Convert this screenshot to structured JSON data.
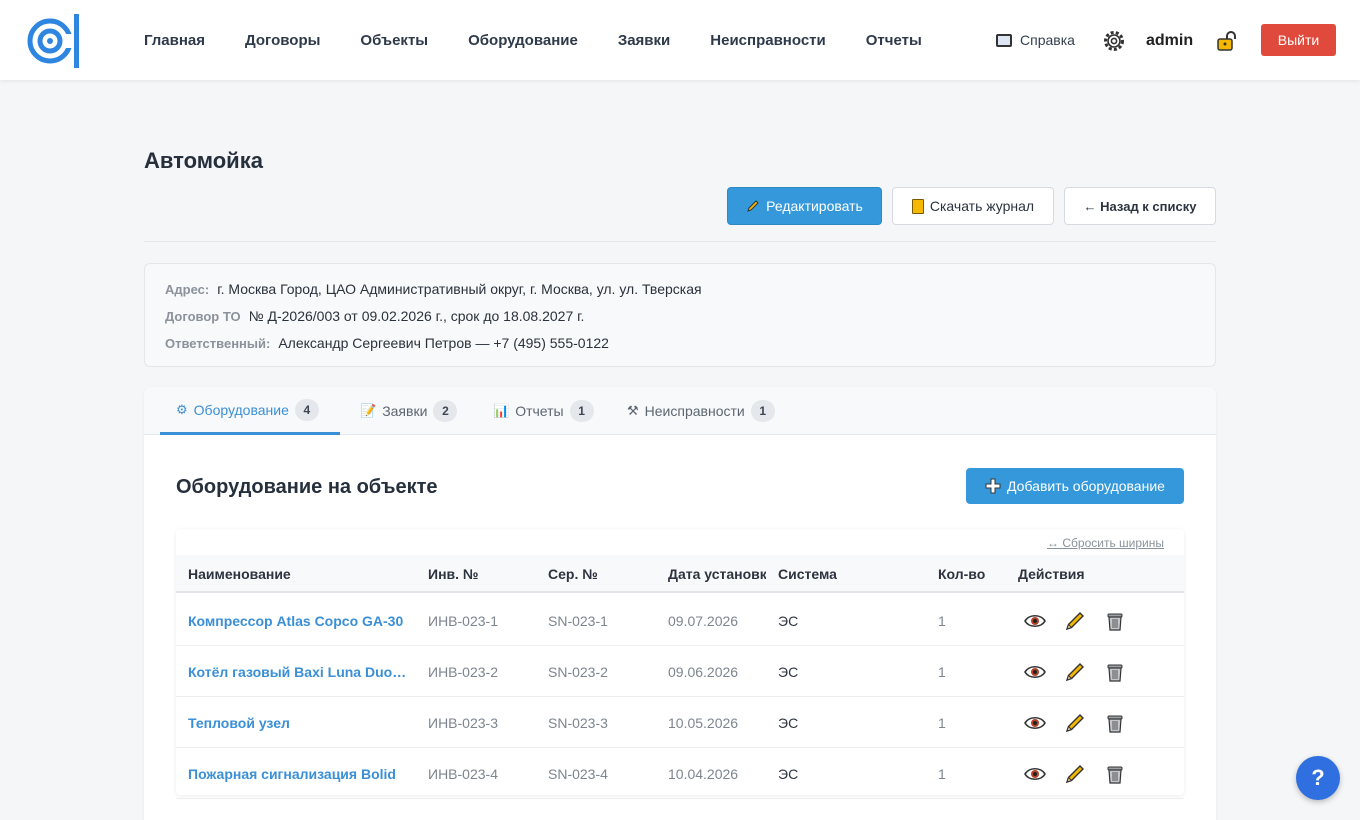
{
  "nav": {
    "items": [
      "Главная",
      "Договоры",
      "Объекты",
      "Оборудование",
      "Заявки",
      "Неисправности",
      "Отчеты"
    ],
    "help_label": "Справка",
    "user": "admin",
    "logout_label": "Выйти"
  },
  "page": {
    "title": "Автомойка",
    "edit_label": "Редактировать",
    "journal_label": "Скачать журнал",
    "back_label": "← Назад к списку"
  },
  "info": {
    "address_label": "Адрес:",
    "address_value": "г. Москва Город, ЦАО Административный округ, г. Москва, ул. ул. Тверская",
    "contract_label": "Договор ТО",
    "contract_value": "№ Д-2026/003 от 09.02.2026 г., срок до 18.08.2027 г.",
    "responsible_label": "Ответственный:",
    "responsible_value": "Александр Сергеевич Петров — +7 (495) 555-0122"
  },
  "tabs": [
    {
      "icon": "⚙",
      "label": "Оборудование",
      "count": "4"
    },
    {
      "icon": "📝",
      "label": "Заявки",
      "count": "2"
    },
    {
      "icon": "📊",
      "label": "Отчеты",
      "count": "1"
    },
    {
      "icon": "⚒",
      "label": "Неисправности",
      "count": "1"
    }
  ],
  "equipment": {
    "title": "Оборудование на объекте",
    "add_label": "Добавить оборудование",
    "reset_widths": "↔ Сбросить ширины",
    "columns": [
      "Наименование",
      "Инв. №",
      "Сер. №",
      "Дата установки",
      "Система",
      "Кол-во",
      "Действия"
    ],
    "rows": [
      {
        "name": "Компрессор Atlas Copco GA-30",
        "inv": "ИНВ-023-1",
        "serial": "SN-023-1",
        "date": "09.07.2026",
        "system": "ЭС",
        "qty": "1"
      },
      {
        "name": "Котёл газовый Baxi Luna Duo-tec",
        "inv": "ИНВ-023-2",
        "serial": "SN-023-2",
        "date": "09.06.2026",
        "system": "ЭС",
        "qty": "1"
      },
      {
        "name": "Тепловой узел",
        "inv": "ИНВ-023-3",
        "serial": "SN-023-3",
        "date": "10.05.2026",
        "system": "ЭС",
        "qty": "1"
      },
      {
        "name": "Пожарная сигнализация Bolid",
        "inv": "ИНВ-023-4",
        "serial": "SN-023-4",
        "date": "10.04.2026",
        "system": "ЭС",
        "qty": "1"
      }
    ]
  },
  "help_fab": "?",
  "colors": {
    "accent": "#3498db",
    "danger": "#e04a3c",
    "fab": "#2f6fe0"
  }
}
